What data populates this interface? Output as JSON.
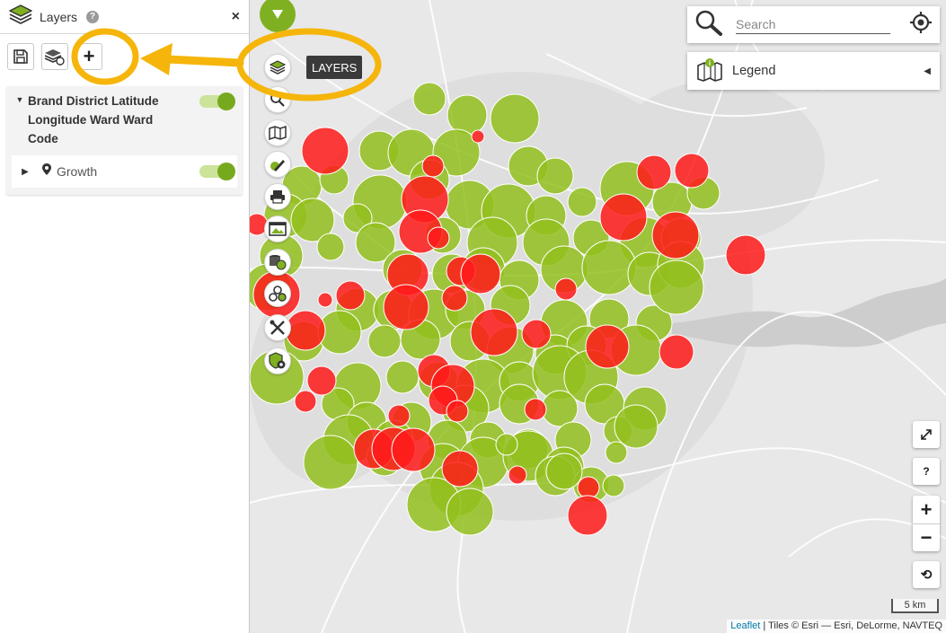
{
  "panel": {
    "title": "Layers",
    "help_icon": "?",
    "close_icon": "×",
    "toolbar": {
      "add_label": "+"
    },
    "layer": {
      "name": "Brand District Latitude Longitude Ward Ward Code",
      "sublayer": "Growth"
    }
  },
  "map_tools": {
    "tooltip": "LAYERS",
    "items": [
      "layers-icon",
      "zoom-select-icon",
      "basemap-icon",
      "draw-icon",
      "print-icon",
      "media-icon",
      "data-globe-icon",
      "analysis-icon",
      "tools-icon",
      "admin-settings-icon"
    ]
  },
  "search": {
    "placeholder": "Search"
  },
  "legend": {
    "label": "Legend",
    "arrow": "◀"
  },
  "controls": {
    "fullscreen": "⤢",
    "help": "?",
    "zoom_in": "+",
    "zoom_out": "−",
    "reset": "⟲"
  },
  "scale": "5 km",
  "attribution": {
    "leaflet": "Leaflet",
    "rest": " | Tiles © Esri — Esri, DeLorme, NAVTEQ"
  },
  "colors": {
    "accent_green": "#7fb022",
    "circle_green": "#93c01f",
    "circle_red": "#ff1a1a",
    "annotation": "#f5b50a"
  }
}
